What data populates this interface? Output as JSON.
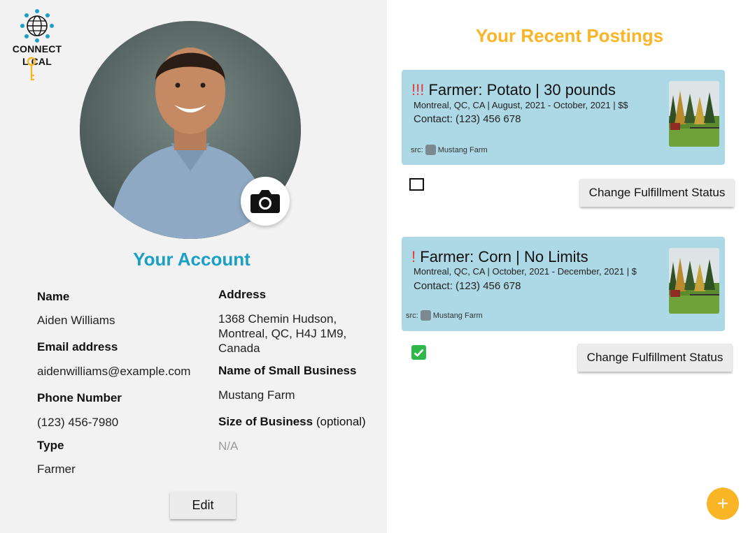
{
  "logo": {
    "line1": "CONNECT",
    "line2": "L CAL",
    "globe_color": "#1a9fc6",
    "key_color": "#f9b526"
  },
  "profile": {
    "photo_icon": "camera-icon"
  },
  "account": {
    "title": "Your Account",
    "name_label": "Name",
    "name_value": "Aiden Williams",
    "email_label": "Email address",
    "email_value": "aidenwilliams@example.com",
    "phone_label": "Phone Number",
    "phone_value": "(123) 456-7980",
    "type_label": "Type",
    "type_value": "Farmer",
    "address_label": "Address",
    "address_line1": "1368 Chemin Hudson,",
    "address_line2": "Montreal, QC, H4J 1M9,",
    "address_line3": "Canada",
    "business_label": "Name of Small Business",
    "business_value": "Mustang Farm",
    "size_label": "Size of Business",
    "size_optional": "(optional)",
    "size_value": "N/A",
    "edit_label": "Edit"
  },
  "postings": {
    "title": "Your Recent Postings",
    "title_color": "#f9b526",
    "items": [
      {
        "priority": "!!!",
        "title": "Farmer: Potato | 30 pounds",
        "meta": "Montreal, QC, CA | August, 2021 - October, 2021 | $$",
        "contact": "Contact: (123) 456 678",
        "src_label": "src:",
        "src_name": "Mustang Farm",
        "fulfilled": false,
        "button_label": "Change Fulfillment Status"
      },
      {
        "priority": "!",
        "title": "Farmer: Corn | No Limits",
        "meta": "Montreal, QC, CA | October, 2021 - December, 2021 | $",
        "contact": "Contact: (123) 456 678",
        "src_label": "src:",
        "src_name": "Mustang Farm",
        "fulfilled": true,
        "button_label": "Change Fulfillment Status"
      }
    ]
  },
  "fab": {
    "label": "+",
    "icon": "plus-icon",
    "color": "#f9b526"
  }
}
